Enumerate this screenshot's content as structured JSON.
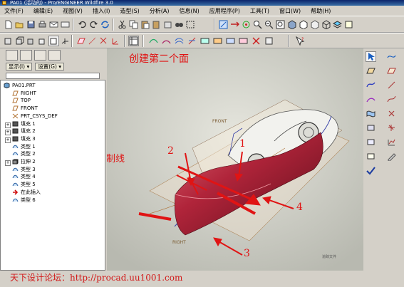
{
  "window": {
    "title": "PA01 (活动的) - Pro/ENGINEER Wildfire 3.0"
  },
  "menu": [
    "文件(F)",
    "编辑(E)",
    "视图(V)",
    "插入(I)",
    "造型(S)",
    "分析(A)",
    "信息(N)",
    "应用程序(P)",
    "工具(T)",
    "窗口(W)",
    "帮助(H)"
  ],
  "panel": {
    "display_label": "显示(I) ▾",
    "settings_label": "设置(G) ▾"
  },
  "tree": {
    "items": [
      {
        "label": "PA01.PRT",
        "icon": "part-icon"
      },
      {
        "label": "RIGHT",
        "icon": "datum-plane-icon"
      },
      {
        "label": "TOP",
        "icon": "datum-plane-icon"
      },
      {
        "label": "FRONT",
        "icon": "datum-plane-icon"
      },
      {
        "label": "PRT_CSYS_DEF",
        "icon": "csys-icon"
      },
      {
        "label": "填充 1",
        "icon": "fill-icon"
      },
      {
        "label": "填充 2",
        "icon": "fill-icon"
      },
      {
        "label": "填充 3",
        "icon": "fill-icon"
      },
      {
        "label": "类型 1",
        "icon": "style-icon"
      },
      {
        "label": "类型 2",
        "icon": "style-icon"
      },
      {
        "label": "拉伸 2",
        "icon": "extrude-icon"
      },
      {
        "label": "类型 3",
        "icon": "style-icon"
      },
      {
        "label": "类型 4",
        "icon": "style-icon"
      },
      {
        "label": "类型 5",
        "icon": "style-icon"
      },
      {
        "label": "在此插入",
        "icon": "insert-here-icon"
      },
      {
        "label": "类型 6",
        "icon": "style-icon"
      }
    ]
  },
  "viewport": {
    "heading": "创建第二个面",
    "center_label": "中间控制线",
    "numbers": [
      "1",
      "2",
      "3",
      "4"
    ],
    "datum_front": "FRONT",
    "datum_right": "RIGHT",
    "corner_text": "追踪文件"
  },
  "footer": {
    "forum_text": "天下设计论坛：http://procad.uu1001.com"
  },
  "colors": {
    "accent_red": "#e01414",
    "title_bar": "#0a246a",
    "surface": "#b0243a"
  }
}
